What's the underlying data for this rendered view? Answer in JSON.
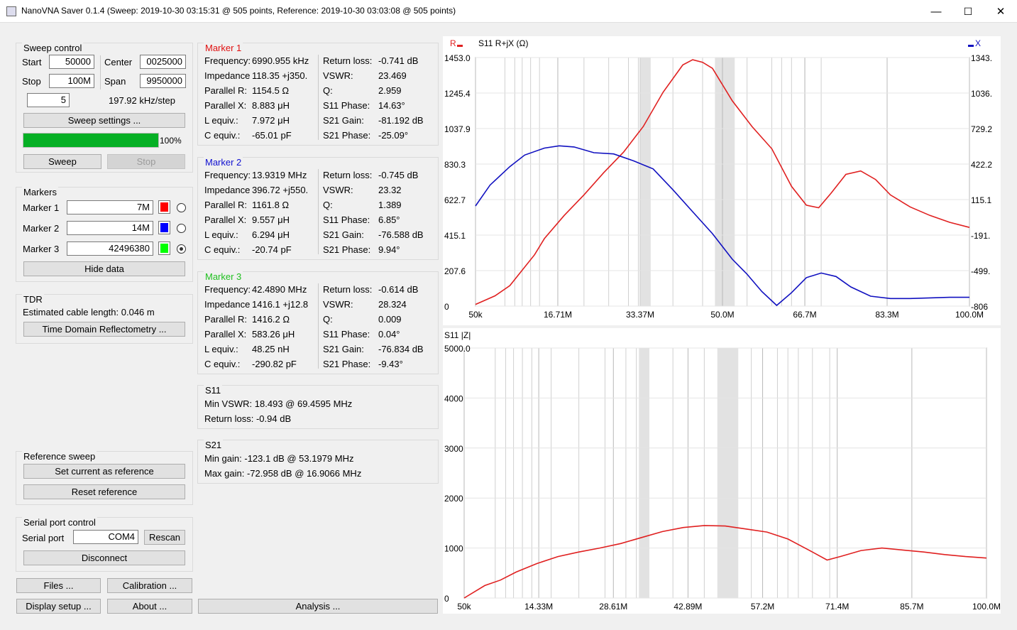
{
  "window": {
    "title": "NanoVNA Saver 0.1.4 (Sweep: 2019-10-30 03:15:31 @ 505 points, Reference: 2019-10-30 03:03:08 @ 505 points)",
    "minimize": "—",
    "maximize": "☐",
    "close": "✕"
  },
  "sweep": {
    "title": "Sweep control",
    "start_label": "Start",
    "start_value": "50000",
    "center_label": "Center",
    "center_value": "0025000",
    "stop_label": "Stop",
    "stop_value": "100M",
    "span_label": "Span",
    "span_value": "9950000",
    "count_value": "5",
    "step_text": "197.92 kHz/step",
    "settings_button": "Sweep settings ...",
    "progress": 100,
    "progress_text": "100%",
    "sweep_button": "Sweep",
    "stop_button": "Stop"
  },
  "markers": {
    "title": "Markers",
    "items": [
      {
        "label": "Marker 1",
        "value": "7M",
        "color": "#ff0000",
        "selected": false
      },
      {
        "label": "Marker 2",
        "value": "14M",
        "color": "#0000ff",
        "selected": false
      },
      {
        "label": "Marker 3",
        "value": "42496380",
        "color": "#00ff00",
        "selected": true
      }
    ],
    "hide_button": "Hide data"
  },
  "tdr": {
    "title": "TDR",
    "cable_text": "Estimated cable length: 0.046 m",
    "button": "Time Domain Reflectometry ..."
  },
  "reference": {
    "title": "Reference sweep",
    "set_button": "Set current as reference",
    "reset_button": "Reset reference"
  },
  "serial": {
    "title": "Serial port control",
    "port_label": "Serial port",
    "port_value": "COM4",
    "rescan_button": "Rescan",
    "disconnect_button": "Disconnect"
  },
  "bottom": {
    "files": "Files ...",
    "calibration": "Calibration ...",
    "display": "Display setup ...",
    "about": "About ...",
    "analysis": "Analysis ..."
  },
  "marker_data": [
    {
      "title": "Marker 1",
      "color": "#e01010",
      "left": [
        [
          "Frequency:",
          "6990.955 kHz"
        ],
        [
          "Impedance:",
          "118.35 +j350."
        ],
        [
          "Parallel R:",
          "1154.5 Ω"
        ],
        [
          "Parallel X:",
          "8.883 μH"
        ],
        [
          "L equiv.:",
          "7.972 μH"
        ],
        [
          "C equiv.:",
          "-65.01 pF"
        ]
      ],
      "right": [
        [
          "Return loss:",
          "-0.741 dB"
        ],
        [
          "VSWR:",
          "23.469"
        ],
        [
          "Q:",
          "2.959"
        ],
        [
          "S11 Phase:",
          "14.63°"
        ],
        [
          "S21 Gain:",
          "-81.192 dB"
        ],
        [
          "S21 Phase:",
          "-25.09°"
        ]
      ]
    },
    {
      "title": "Marker 2",
      "color": "#1010d0",
      "left": [
        [
          "Frequency:",
          "13.9319 MHz"
        ],
        [
          "Impedance:",
          "396.72 +j550."
        ],
        [
          "Parallel R:",
          "1161.8 Ω"
        ],
        [
          "Parallel X:",
          "9.557 μH"
        ],
        [
          "L equiv.:",
          "6.294 μH"
        ],
        [
          "C equiv.:",
          "-20.74 pF"
        ]
      ],
      "right": [
        [
          "Return loss:",
          "-0.745 dB"
        ],
        [
          "VSWR:",
          "23.32"
        ],
        [
          "Q:",
          "1.389"
        ],
        [
          "S11 Phase:",
          "6.85°"
        ],
        [
          "S21 Gain:",
          "-76.588 dB"
        ],
        [
          "S21 Phase:",
          "9.94°"
        ]
      ]
    },
    {
      "title": "Marker 3",
      "color": "#20c020",
      "left": [
        [
          "Frequency:",
          "42.4890 MHz"
        ],
        [
          "Impedance:",
          "1416.1 +j12.8"
        ],
        [
          "Parallel R:",
          "1416.2 Ω"
        ],
        [
          "Parallel X:",
          "583.26 μH"
        ],
        [
          "L equiv.:",
          "48.25 nH"
        ],
        [
          "C equiv.:",
          "-290.82 pF"
        ]
      ],
      "right": [
        [
          "Return loss:",
          "-0.614 dB"
        ],
        [
          "VSWR:",
          "28.324"
        ],
        [
          "Q:",
          "0.009"
        ],
        [
          "S11 Phase:",
          "0.04°"
        ],
        [
          "S21 Gain:",
          "-76.834 dB"
        ],
        [
          "S21 Phase:",
          "-9.43°"
        ]
      ]
    }
  ],
  "s11_summary": {
    "title": "S11",
    "min_vswr": "Min VSWR:  18.493 @ 69.4595 MHz",
    "return_loss": "Return loss: -0.94 dB"
  },
  "s21_summary": {
    "title": "S21",
    "min_gain": "Min gain:  -123.1 dB @ 53.1979 MHz",
    "max_gain": "Max gain: -72.958 dB @ 16.9066 MHz"
  },
  "chart_data": [
    {
      "type": "line",
      "title": "S11  R+jX (Ω)",
      "legend_left": "R",
      "legend_right": "X",
      "x_ticks": [
        "50k",
        "16.71M",
        "33.37M",
        "50.0M",
        "66.7M",
        "83.3M",
        "100.0M"
      ],
      "y_left_ticks": [
        "1453.0",
        "1245.4",
        "1037.9",
        "830.3",
        "622.7",
        "415.1",
        "207.6",
        "0"
      ],
      "y_right_ticks": [
        "1343.",
        "1036.",
        "729.2",
        "422.2",
        "115.1",
        "-191.",
        "-499.",
        "-806"
      ],
      "xlim_mhz": [
        0.05,
        100
      ],
      "ylim_r": [
        0,
        1453
      ],
      "ylim_x": [
        -806,
        1343
      ],
      "series": [
        {
          "name": "R",
          "color": "#e02020",
          "x": [
            0.05,
            4,
            7,
            12,
            14,
            18,
            22,
            26,
            30,
            34,
            38,
            42,
            44,
            46,
            48,
            52,
            56,
            60,
            64,
            67,
            69.5,
            72,
            75,
            78,
            81,
            84,
            88,
            92,
            96,
            100
          ],
          "y": [
            10,
            60,
            120,
            300,
            395,
            530,
            650,
            780,
            900,
            1050,
            1250,
            1410,
            1440,
            1425,
            1390,
            1200,
            1050,
            920,
            700,
            590,
            575,
            660,
            770,
            790,
            740,
            650,
            580,
            530,
            490,
            460
          ]
        },
        {
          "name": "X",
          "color": "#1010c0",
          "x": [
            0.05,
            3,
            7,
            10,
            14,
            17,
            20,
            24,
            28,
            32,
            36,
            40,
            44,
            48,
            52,
            55,
            58,
            61,
            64,
            67,
            70,
            73,
            76,
            80,
            84,
            88,
            92,
            96,
            100
          ],
          "y": [
            60,
            240,
            400,
            500,
            560,
            580,
            570,
            520,
            510,
            450,
            380,
            200,
            10,
            -180,
            -400,
            -530,
            -680,
            -800,
            -690,
            -560,
            -520,
            -550,
            -640,
            -720,
            -740,
            -740,
            -735,
            -730,
            -730
          ]
        }
      ]
    },
    {
      "type": "line",
      "title": "S11  |Z|",
      "x_ticks": [
        "50k",
        "14.33M",
        "28.61M",
        "42.89M",
        "57.2M",
        "71.4M",
        "85.7M",
        "100.0M"
      ],
      "y_ticks": [
        "5000.0",
        "4000",
        "3000",
        "2000",
        "1000",
        "0"
      ],
      "xlim_mhz": [
        0.05,
        100
      ],
      "ylim": [
        0,
        5000
      ],
      "series": [
        {
          "name": "|Z|",
          "color": "#e02020",
          "x": [
            0.05,
            4,
            7,
            10,
            14,
            18,
            22,
            26,
            30,
            34,
            38,
            42,
            46,
            50,
            54,
            58,
            62,
            66,
            69.5,
            72,
            76,
            80,
            84,
            88,
            92,
            96,
            100
          ],
          "y": [
            0,
            250,
            360,
            520,
            690,
            830,
            920,
            1000,
            1090,
            1210,
            1330,
            1410,
            1450,
            1440,
            1380,
            1320,
            1180,
            960,
            760,
            830,
            950,
            1000,
            960,
            920,
            870,
            830,
            800
          ]
        }
      ]
    }
  ]
}
